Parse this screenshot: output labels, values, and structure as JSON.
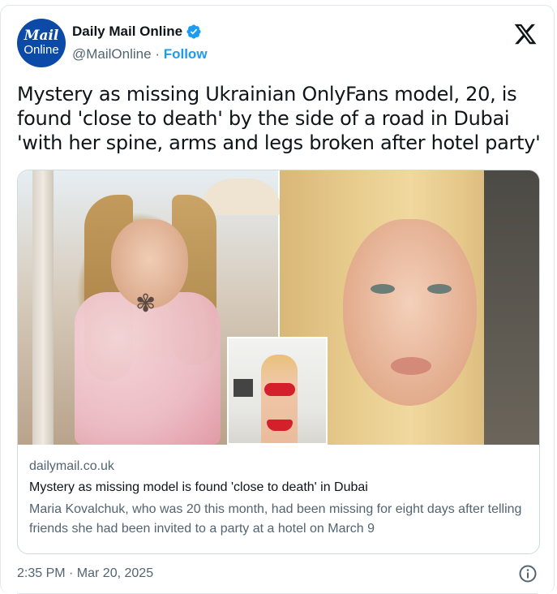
{
  "author": {
    "avatar_line1": "Mail",
    "avatar_line2": "Online",
    "name": "Daily Mail Online",
    "handle": "@MailOnline",
    "separator": "·",
    "follow_label": "Follow"
  },
  "icons": {
    "verified": "verified-badge-icon",
    "platform": "x-logo-icon",
    "info": "info-icon"
  },
  "colors": {
    "accent": "#1d9bf0",
    "text_primary": "#0f1419",
    "text_secondary": "#536471",
    "avatar_bg": "#0b4aa6"
  },
  "post": {
    "text": "Mystery as missing Ukrainian OnlyFans model, 20, is found 'close to death' by the side of a road in Dubai 'with her spine, arms and legs broken after hotel party'"
  },
  "link_card": {
    "domain": "dailymail.co.uk",
    "title": "Mystery as missing model is found 'close to death' in Dubai",
    "description": "Maria Kovalchuk, who was 20 this month, had been missing for eight days after telling friends she had been invited to a party at a hotel on March 9"
  },
  "footer": {
    "timestamp": "2:35 PM · Mar 20, 2025"
  }
}
